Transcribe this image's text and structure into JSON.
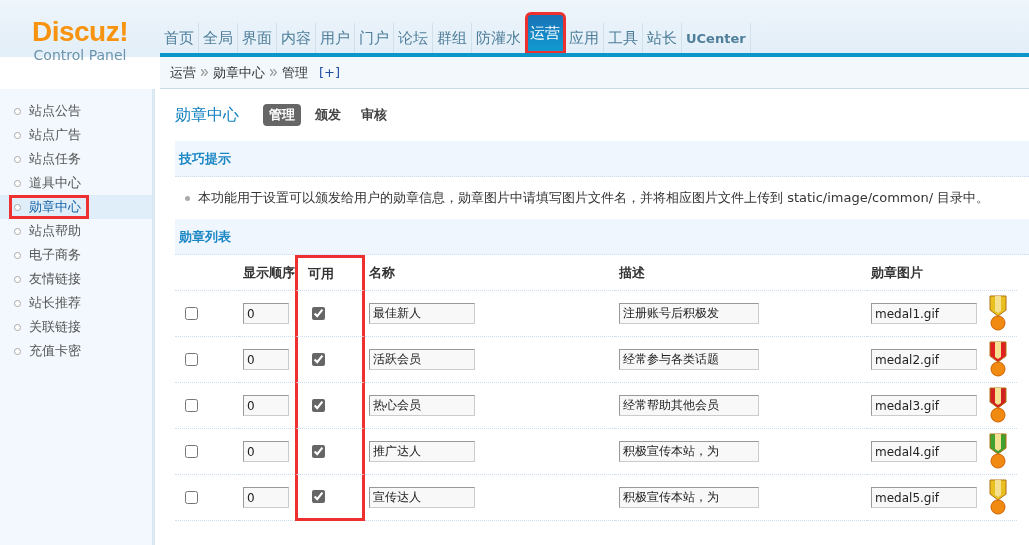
{
  "logo": {
    "brand": "Discuz!",
    "subtitle": "Control Panel"
  },
  "nav": [
    {
      "label": "首页",
      "selected": false,
      "highlighted": false
    },
    {
      "label": "全局",
      "selected": false,
      "highlighted": false
    },
    {
      "label": "界面",
      "selected": false,
      "highlighted": false
    },
    {
      "label": "内容",
      "selected": false,
      "highlighted": false
    },
    {
      "label": "用户",
      "selected": false,
      "highlighted": false
    },
    {
      "label": "门户",
      "selected": false,
      "highlighted": false
    },
    {
      "label": "论坛",
      "selected": false,
      "highlighted": false
    },
    {
      "label": "群组",
      "selected": false,
      "highlighted": false
    },
    {
      "label": "防灌水",
      "selected": false,
      "highlighted": false
    },
    {
      "label": "运营",
      "selected": true,
      "highlighted": true
    },
    {
      "label": "应用",
      "selected": false,
      "highlighted": false
    },
    {
      "label": "工具",
      "selected": false,
      "highlighted": false
    },
    {
      "label": "站长",
      "selected": false,
      "highlighted": false
    },
    {
      "label": "UCenter",
      "selected": false,
      "highlighted": false
    }
  ],
  "breadcrumb": {
    "items": [
      "运营",
      "勋章中心",
      "管理"
    ],
    "add": "[+]"
  },
  "sidebar": {
    "items": [
      {
        "label": "站点公告",
        "selected": false,
        "highlighted": false
      },
      {
        "label": "站点广告",
        "selected": false,
        "highlighted": false
      },
      {
        "label": "站点任务",
        "selected": false,
        "highlighted": false
      },
      {
        "label": "道具中心",
        "selected": false,
        "highlighted": false
      },
      {
        "label": "勋章中心",
        "selected": true,
        "highlighted": true
      },
      {
        "label": "站点帮助",
        "selected": false,
        "highlighted": false
      },
      {
        "label": "电子商务",
        "selected": false,
        "highlighted": false
      },
      {
        "label": "友情链接",
        "selected": false,
        "highlighted": false
      },
      {
        "label": "站长推荐",
        "selected": false,
        "highlighted": false
      },
      {
        "label": "关联链接",
        "selected": false,
        "highlighted": false
      },
      {
        "label": "充值卡密",
        "selected": false,
        "highlighted": false
      }
    ]
  },
  "page": {
    "title": "勋章中心",
    "tabs": [
      {
        "label": "管理",
        "selected": true
      },
      {
        "label": "颁发",
        "selected": false
      },
      {
        "label": "审核",
        "selected": false
      }
    ]
  },
  "tips": {
    "title": "技巧提示",
    "text": "本功能用于设置可以颁发给用户的勋章信息，勋章图片中请填写图片文件名，并将相应图片文件上传到 static/image/common/ 目录中。"
  },
  "table": {
    "title": "勋章列表",
    "columns": [
      {
        "highlighted": false
      },
      {
        "label": "显示顺序",
        "highlighted": false
      },
      {
        "label": "可用",
        "highlighted": true
      },
      {
        "label": "名称",
        "highlighted": false
      },
      {
        "label": "描述",
        "highlighted": false
      },
      {
        "label": "勋章图片",
        "highlighted": false
      }
    ],
    "rows": [
      {
        "selected": false,
        "order": "0",
        "enabled": true,
        "name": "最佳新人",
        "description": "注册账号后积极发",
        "image": "medal1.gif",
        "color": "#e8c020"
      },
      {
        "selected": false,
        "order": "0",
        "enabled": true,
        "name": "活跃会员",
        "description": "经常参与各类话题",
        "image": "medal2.gif",
        "color": "#e02020"
      },
      {
        "selected": false,
        "order": "0",
        "enabled": true,
        "name": "热心会员",
        "description": "经常帮助其他会员",
        "image": "medal3.gif",
        "color": "#d02020"
      },
      {
        "selected": false,
        "order": "0",
        "enabled": true,
        "name": "推广达人",
        "description": "积极宣传本站，为",
        "image": "medal4.gif",
        "color": "#40a030"
      },
      {
        "selected": false,
        "order": "0",
        "enabled": true,
        "name": "宣传达人",
        "description": "积极宣传本站，为",
        "image": "medal5.gif",
        "color": "#e8c020"
      }
    ]
  }
}
